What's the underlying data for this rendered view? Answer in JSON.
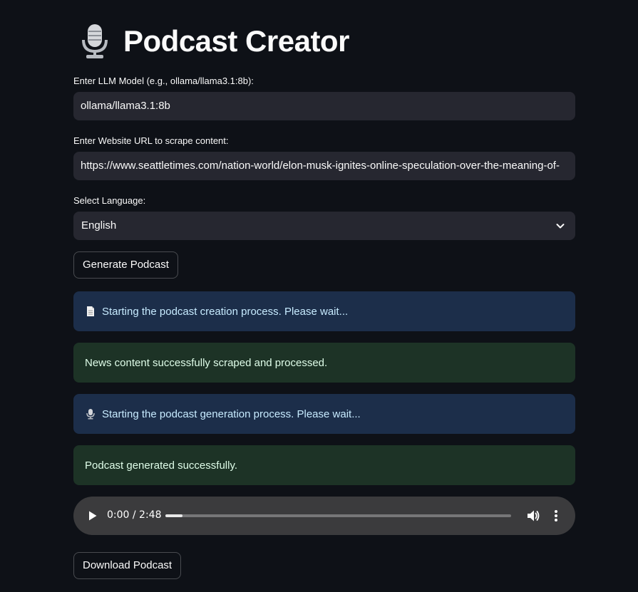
{
  "header": {
    "title": "Podcast Creator",
    "icon": "microphone-icon"
  },
  "form": {
    "model_label": "Enter LLM Model (e.g., ollama/llama3.1:8b):",
    "model_value": "ollama/llama3.1:8b",
    "url_label": "Enter Website URL to scrape content:",
    "url_value": "https://www.seattletimes.com/nation-world/elon-musk-ignites-online-speculation-over-the-meaning-of-",
    "language_label": "Select Language:",
    "language_value": "English",
    "generate_button": "Generate Podcast"
  },
  "messages": [
    {
      "type": "info",
      "icon": "document-icon",
      "text": "Starting the podcast creation process. Please wait..."
    },
    {
      "type": "success",
      "text": "News content successfully scraped and processed."
    },
    {
      "type": "info",
      "icon": "microphone-icon",
      "text": "Starting the podcast generation process. Please wait..."
    },
    {
      "type": "success",
      "text": "Podcast generated successfully."
    }
  ],
  "audio": {
    "time_display": "0:00 / 2:48",
    "progress_fraction": 0.05
  },
  "download_button": "Download Podcast",
  "colors": {
    "background": "#0e1117",
    "input_bg": "#262730",
    "info_bg": "#1c2e4a",
    "info_text": "#c7ebff",
    "success_bg": "#1d3326",
    "success_text": "#dffde9"
  }
}
